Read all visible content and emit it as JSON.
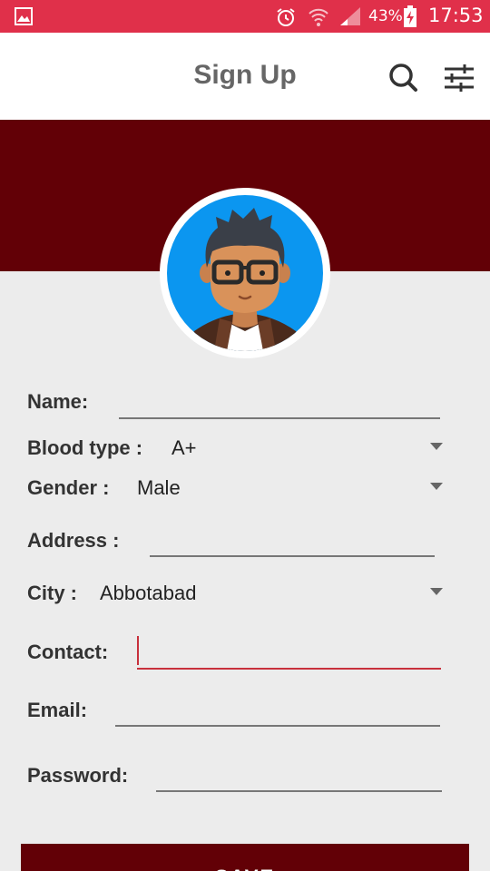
{
  "status_bar": {
    "battery_percent": "43%",
    "time": "17:53",
    "icons": [
      "gallery-icon",
      "alarm-icon",
      "wifi-icon",
      "signal-icon",
      "battery-charging-icon"
    ]
  },
  "app_bar": {
    "title": "Sign Up",
    "icons": [
      "search-icon",
      "tune-icon"
    ]
  },
  "colors": {
    "status_bar": "#e0304a",
    "header_band": "#620006",
    "active_field": "#c8303c"
  },
  "form": {
    "name_label": "Name:",
    "blood_type_label": "Blood type :",
    "blood_type_value": "A+",
    "gender_label": "Gender :",
    "gender_value": "Male",
    "address_label": "Address :",
    "city_label": "City :",
    "city_value": "Abbotabad",
    "contact_label": "Contact:",
    "email_label": "Email:",
    "password_label": "Password:"
  },
  "save_button_label": "SAVE"
}
